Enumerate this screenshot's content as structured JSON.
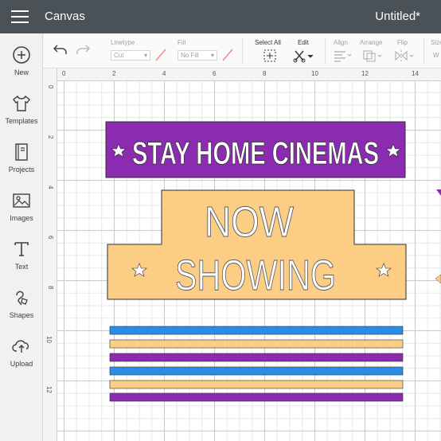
{
  "app": {
    "title": "Canvas",
    "document_title": "Untitled*"
  },
  "sidebar": {
    "items": [
      {
        "label": "New",
        "icon": "plus-circle-icon"
      },
      {
        "label": "Templates",
        "icon": "tshirt-icon"
      },
      {
        "label": "Projects",
        "icon": "book-icon"
      },
      {
        "label": "Images",
        "icon": "image-icon"
      },
      {
        "label": "Text",
        "icon": "text-t-icon"
      },
      {
        "label": "Shapes",
        "icon": "shapes-icon"
      },
      {
        "label": "Upload",
        "icon": "cloud-upload-icon"
      }
    ]
  },
  "toolbar": {
    "linetype_label": "Linetype",
    "linetype_value": "Cut",
    "fill_label": "Fill",
    "fill_value": "No Fill",
    "select_all_label": "Select All",
    "edit_label": "Edit",
    "align_label": "Align",
    "arrange_label": "Arrange",
    "flip_label": "Flip",
    "size_label": "Size",
    "size_w_label": "W"
  },
  "ruler": {
    "horizontal": [
      "0",
      "2",
      "4",
      "6",
      "8",
      "10",
      "12",
      "14"
    ],
    "vertical": [
      "0",
      "2",
      "4",
      "6",
      "8",
      "10",
      "12"
    ]
  },
  "design": {
    "banner_text": "STAY HOME CINEMAS",
    "sign_line1": "NOW",
    "sign_line2": "SHOWING",
    "colors": {
      "purple": "#8a2bb0",
      "orange": "#fccd85",
      "blue": "#2a8ce6",
      "outline": "#2f2f2f"
    },
    "stripes": [
      "blue",
      "orange",
      "purple",
      "blue",
      "orange",
      "purple"
    ]
  }
}
